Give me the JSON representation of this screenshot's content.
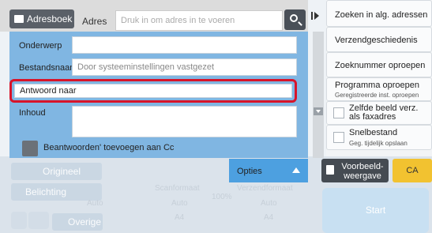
{
  "header": {
    "address_book_label": "Adresboek",
    "address_label": "Adres",
    "address_placeholder": "Druk in om adres in te voeren"
  },
  "form": {
    "subject_label": "Onderwerp",
    "subject_value": "",
    "filename_label": "Bestandsnaam",
    "filename_value": "Door systeeminstellingen vastgezet",
    "reply_to_label": "Antwoord naar",
    "body_label": "Inhoud",
    "body_value": "",
    "add_reply_cc_label": "Beantwoorden' toevoegen aan Cc",
    "options_label": "Opties"
  },
  "menu": {
    "items": [
      {
        "label": "Zoeken in alg. adressen"
      },
      {
        "label": "Verzendgeschiedenis"
      },
      {
        "label": "Zoeknummer oproepen"
      },
      {
        "label": "Programma oproepen",
        "sub": "Geregistreerde inst. oproepen"
      },
      {
        "label": "Zelfde beeld verz. als faxadres"
      },
      {
        "label": "Snelbestand",
        "sub": "Geg. tijdelijk opslaan"
      }
    ]
  },
  "footer": {
    "preview_label": "Voorbeeld-weergave",
    "ca_label": "CA"
  },
  "background": {
    "original_label": "Origineel",
    "exposure_label": "Belichting",
    "exposure_value": "Auto",
    "other_label": "Overige",
    "scan_size_label": "Scanformaat",
    "scan_size_value": "Auto",
    "scan_size_paper": "A4",
    "ratio_value": "100%",
    "send_size_label": "Verzendformaat",
    "send_size_value": "Auto",
    "send_size_paper": "A4",
    "start_label": "Start"
  },
  "colors": {
    "panel": "#80b6e2",
    "highlight": "#d8142a",
    "ca_button": "#f2c230",
    "preview_button": "#454b52"
  }
}
